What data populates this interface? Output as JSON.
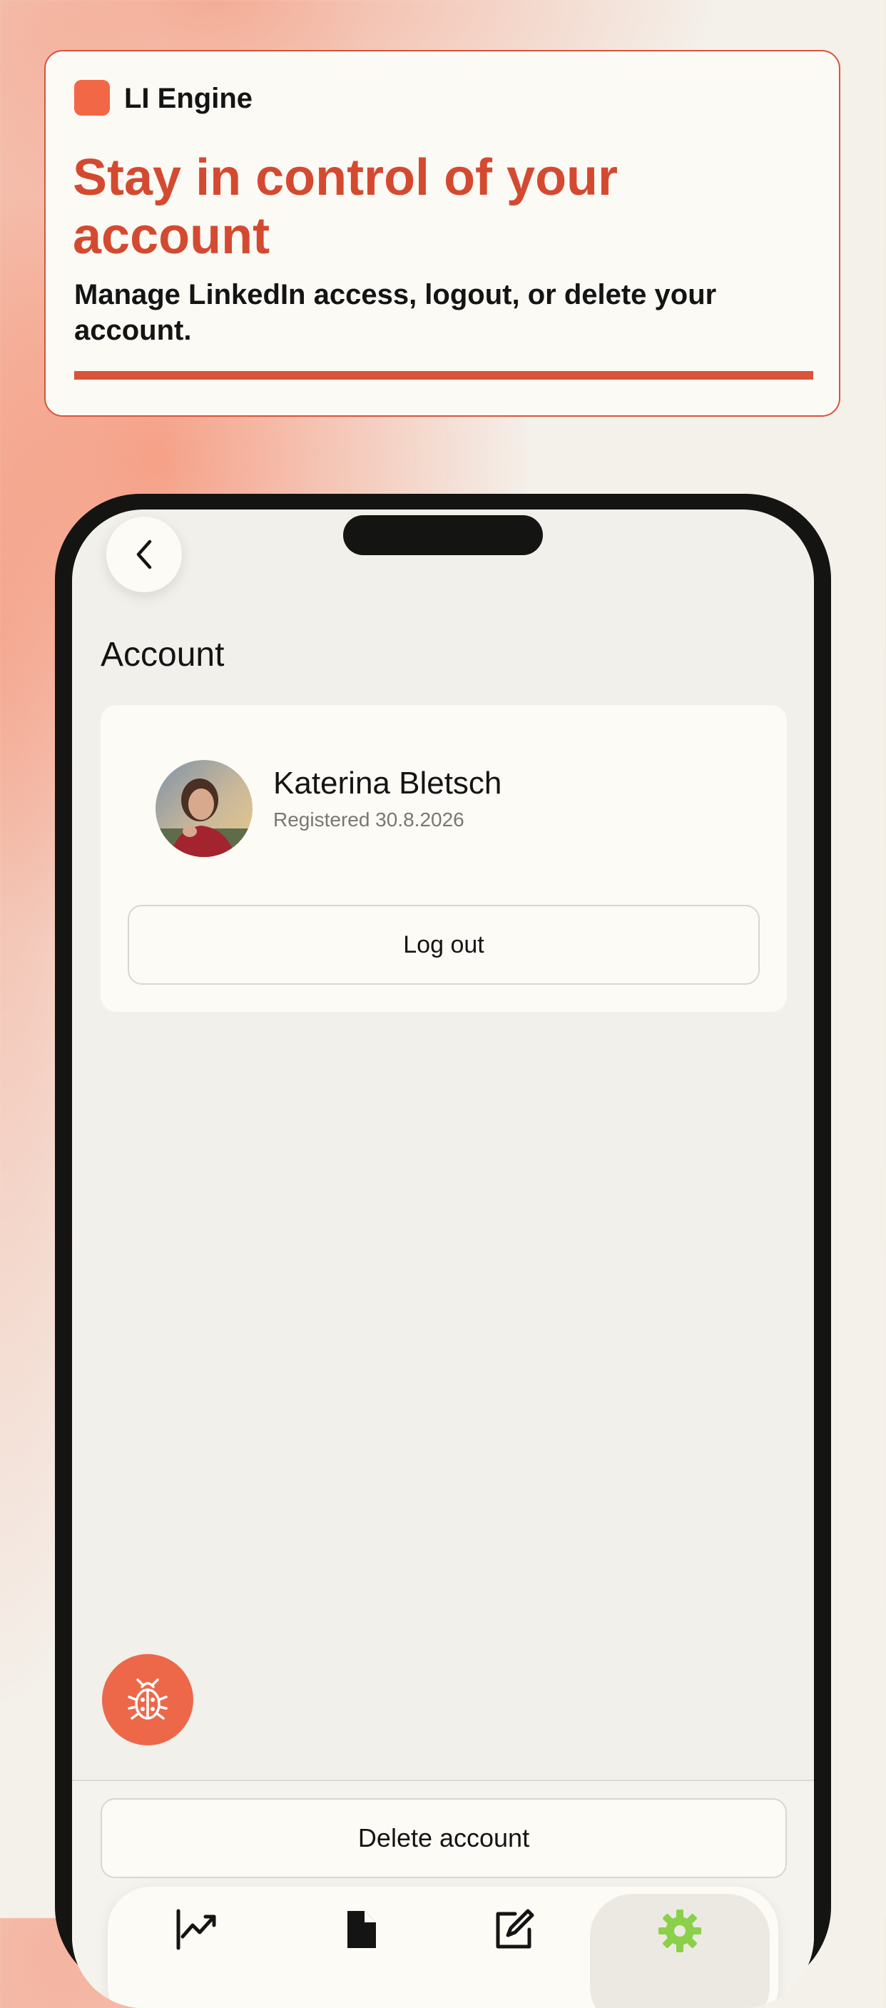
{
  "promo": {
    "brand": "LI Engine",
    "headline": "Stay in control of your account",
    "subline": "Manage LinkedIn access, logout, or delete your account."
  },
  "screen": {
    "back_icon": "chevron-left-icon",
    "title": "Account"
  },
  "profile": {
    "name": "Katerina Bletsch",
    "registered": "Registered 30.8.2026",
    "logout_label": "Log out"
  },
  "debug": {
    "icon": "ladybug-icon"
  },
  "actions": {
    "delete_label": "Delete account"
  },
  "tabbar": {
    "tabs": [
      {
        "icon": "analytics-chart-icon",
        "active": false
      },
      {
        "icon": "document-icon",
        "active": false
      },
      {
        "icon": "compose-icon",
        "active": false
      },
      {
        "icon": "gear-icon",
        "active": true
      }
    ]
  },
  "colors": {
    "accent": "#d44a30",
    "brand_dot": "#f26746",
    "fab": "#ec6849",
    "active_tab_icon": "#8bd04a"
  }
}
